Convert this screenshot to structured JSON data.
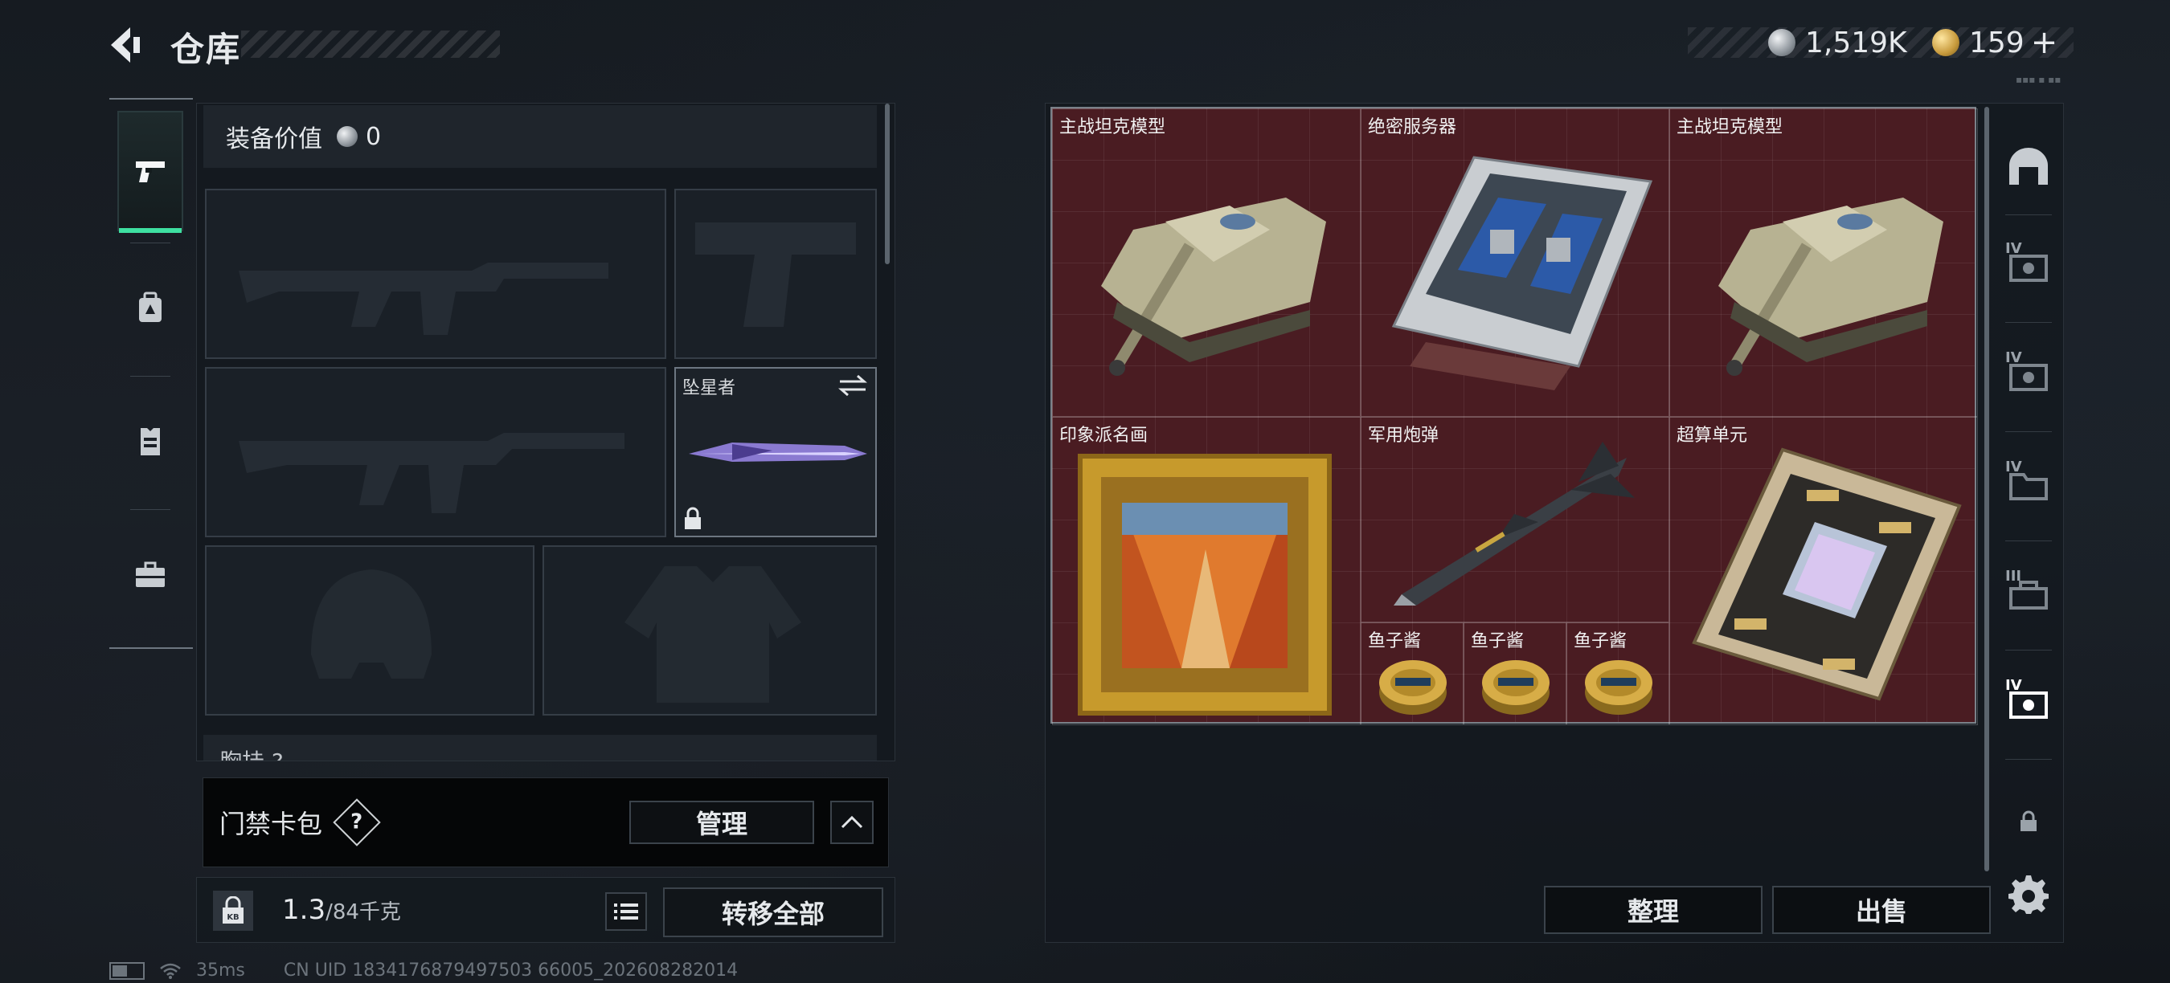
{
  "header": {
    "title": "仓库",
    "silver_amount": "1,519K",
    "gold_amount": "159",
    "add_label": "+"
  },
  "rail": {
    "items": [
      {
        "icon": "pistol-icon",
        "active": true
      },
      {
        "icon": "backpack-icon",
        "active": false
      },
      {
        "icon": "vest-icon",
        "active": false
      },
      {
        "icon": "briefcase-icon",
        "active": false
      }
    ]
  },
  "equipment": {
    "value_label": "装备价值",
    "value_amount": "0",
    "melee_name": "坠星者",
    "chest_label": "胸挂 ?"
  },
  "keycard": {
    "label": "门禁卡包",
    "help": "?",
    "manage_label": "管理"
  },
  "carry": {
    "current": "1.3",
    "capacity": "/84千克",
    "lock_badge": "KB",
    "transfer_label": "转移全部"
  },
  "status": {
    "ping": "35ms",
    "uid": "CN UID 1834176879497503 66005_202608282014"
  },
  "storage": {
    "items": [
      {
        "name": "主战坦克模型"
      },
      {
        "name": "绝密服务器"
      },
      {
        "name": "主战坦克模型"
      },
      {
        "name": "印象派名画"
      },
      {
        "name": "军用炮弹"
      },
      {
        "name": "超算单元"
      },
      {
        "name": "鱼子酱"
      },
      {
        "name": "鱼子酱"
      },
      {
        "name": "鱼子酱"
      }
    ],
    "sort_label": "整理",
    "sell_label": "出售"
  },
  "right_rail": {
    "tiers": [
      "IV",
      "IV",
      "IV",
      "III",
      "IV"
    ]
  },
  "colors": {
    "accent": "#3ee0a1",
    "grid_bg": "#4a1c22",
    "panel_bg": "#14191f"
  }
}
